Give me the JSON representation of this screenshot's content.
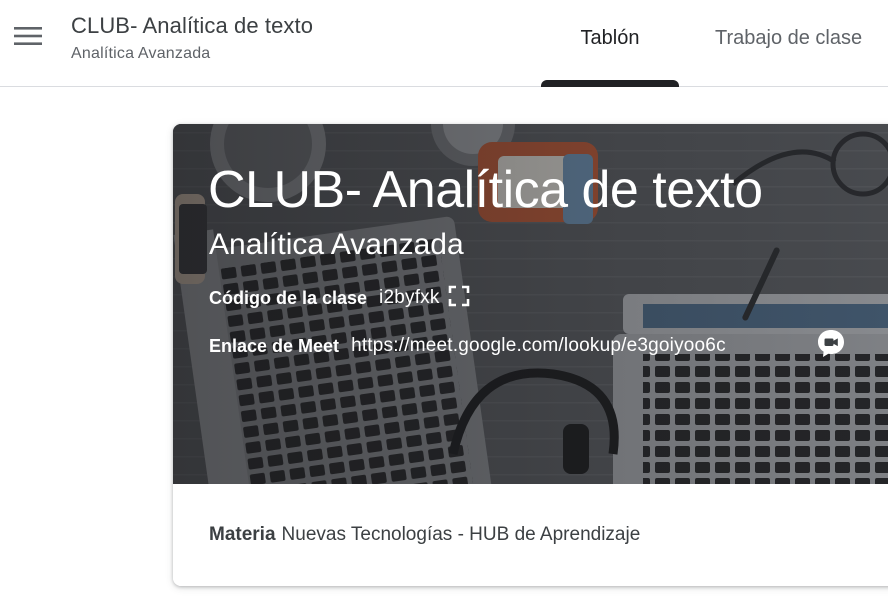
{
  "header": {
    "menu_icon": "hamburger-menu-icon",
    "course_title": "CLUB- Analítica de texto",
    "course_section": "Analítica Avanzada",
    "tabs": [
      {
        "label": "Tablón",
        "selected": true
      },
      {
        "label": "Trabajo de clase",
        "selected": false
      }
    ]
  },
  "banner": {
    "title": "CLUB- Analítica de texto",
    "subtitle": "Analítica Avanzada",
    "class_code_label": "Código de la clase",
    "class_code": "i2byfxk",
    "fullscreen_icon": "fullscreen-icon",
    "meet_label": "Enlace de Meet",
    "meet_link": "https://meet.google.com/lookup/e3goiyoo6c",
    "meet_icon": "video-camera-icon"
  },
  "details": {
    "subject_label": "Materia",
    "subject_value": "Nuevas Tecnologías - HUB de Aprendizaje"
  },
  "colors": {
    "primary_text": "#202124",
    "secondary_text": "#5f6368",
    "divider": "#dadce0"
  }
}
